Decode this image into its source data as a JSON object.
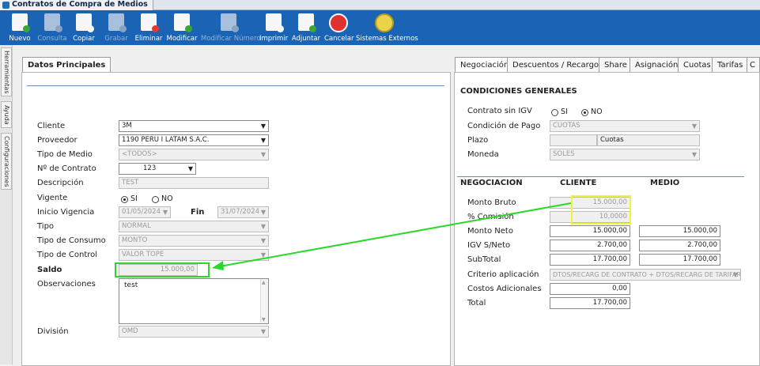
{
  "window": {
    "title": "Contratos de Compra de Medios"
  },
  "toolbar": [
    {
      "label": "Nuevo",
      "icon": "new-document-icon",
      "enabled": true
    },
    {
      "label": "Consulta",
      "icon": "query-icon",
      "enabled": false
    },
    {
      "label": "Copiar",
      "icon": "copy-icon",
      "enabled": true
    },
    {
      "label": "Grabar",
      "icon": "save-icon",
      "enabled": false
    },
    {
      "label": "Eliminar",
      "icon": "delete-icon",
      "enabled": true
    },
    {
      "label": "Modificar",
      "icon": "edit-icon",
      "enabled": true
    },
    {
      "label": "Modificar Número",
      "icon": "edit-number-icon",
      "enabled": false
    },
    {
      "label": "Imprimir",
      "icon": "printer-icon",
      "enabled": true
    },
    {
      "label": "Adjuntar",
      "icon": "attach-icon",
      "enabled": true
    },
    {
      "label": "Cancelar",
      "icon": "cancel-icon",
      "enabled": true
    },
    {
      "label": "Sistemas Externos",
      "icon": "external-systems-icon",
      "enabled": true
    }
  ],
  "side_tabs": [
    "Herramientas",
    "Ayuda",
    "Configuraciones"
  ],
  "left": {
    "tab": "Datos Principales",
    "fields": {
      "cliente": {
        "label": "Cliente",
        "value": "3M"
      },
      "proveedor": {
        "label": "Proveedor",
        "value": "1190 PERU I LATAM S.A.C."
      },
      "tipo_medio": {
        "label": "Tipo de Medio",
        "value": "<TODOS>"
      },
      "nro_contrato": {
        "label": "Nº de Contrato",
        "value": "123"
      },
      "descripcion": {
        "label": "Descripción",
        "value": "TEST"
      },
      "vigente": {
        "label": "Vigente",
        "si": "SI",
        "no": "NO",
        "selected": "SI"
      },
      "inicio_vigencia": {
        "label": "Inicio Vigencia",
        "value": "01/05/2024",
        "fin_label": "Fin",
        "fin_value": "31/07/2024"
      },
      "tipo": {
        "label": "Tipo",
        "value": "NORMAL"
      },
      "tipo_consumo": {
        "label": "Tipo de Consumo",
        "value": "MONTO"
      },
      "tipo_control": {
        "label": "Tipo de Control",
        "value": "VALOR TOPE"
      },
      "saldo": {
        "label": "Saldo",
        "value": "15.000,00"
      },
      "observaciones": {
        "label": "Observaciones",
        "value": "test"
      },
      "division": {
        "label": "División",
        "value": "OMD"
      }
    }
  },
  "right": {
    "tabs": [
      "Negociación",
      "Descuentos / Recargos",
      "Share",
      "Asignación",
      "Cuotas",
      "Tarifas",
      "C"
    ],
    "active_tab": "Negociación",
    "condiciones": {
      "title": "CONDICIONES GENERALES",
      "contrato_sin_igv": {
        "label": "Contrato sin IGV",
        "si": "SI",
        "no": "NO",
        "selected": "NO"
      },
      "condicion_pago": {
        "label": "Condición de Pago",
        "value": "CUOTAS"
      },
      "plazo": {
        "label": "Plazo",
        "value": "",
        "unit": "Cuotas"
      },
      "moneda": {
        "label": "Moneda",
        "value": "SOLES"
      }
    },
    "negociacion": {
      "title": "NEGOCIACION",
      "col_cliente": "CLIENTE",
      "col_medio": "MEDIO",
      "rows": {
        "monto_bruto": {
          "label": "Monto Bruto",
          "cliente": "15.000,00"
        },
        "comision": {
          "label": "% Comisión",
          "cliente": "10,0000"
        },
        "monto_neto": {
          "label": "Monto Neto",
          "cliente": "15.000,00",
          "medio": "15.000,00"
        },
        "igv_neto": {
          "label": "IGV S/Neto",
          "cliente": "2.700,00",
          "medio": "2.700,00"
        },
        "subtotal": {
          "label": "SubTotal",
          "cliente": "17.700,00",
          "medio": "17.700,00"
        },
        "criterio": {
          "label": "Criterio aplicación",
          "value": "DTOS/RECARG DE CONTRATO + DTOS/RECARG DE TARIFARIO"
        },
        "costos_adicionales": {
          "label": "Costos Adicionales",
          "cliente": "0,00"
        },
        "total": {
          "label": "Total",
          "cliente": "17.700,00"
        }
      }
    }
  },
  "colors": {
    "toolbar": "#1b63b4",
    "highlight_green": "#2bd82b",
    "highlight_yellow": "#f3f335"
  }
}
